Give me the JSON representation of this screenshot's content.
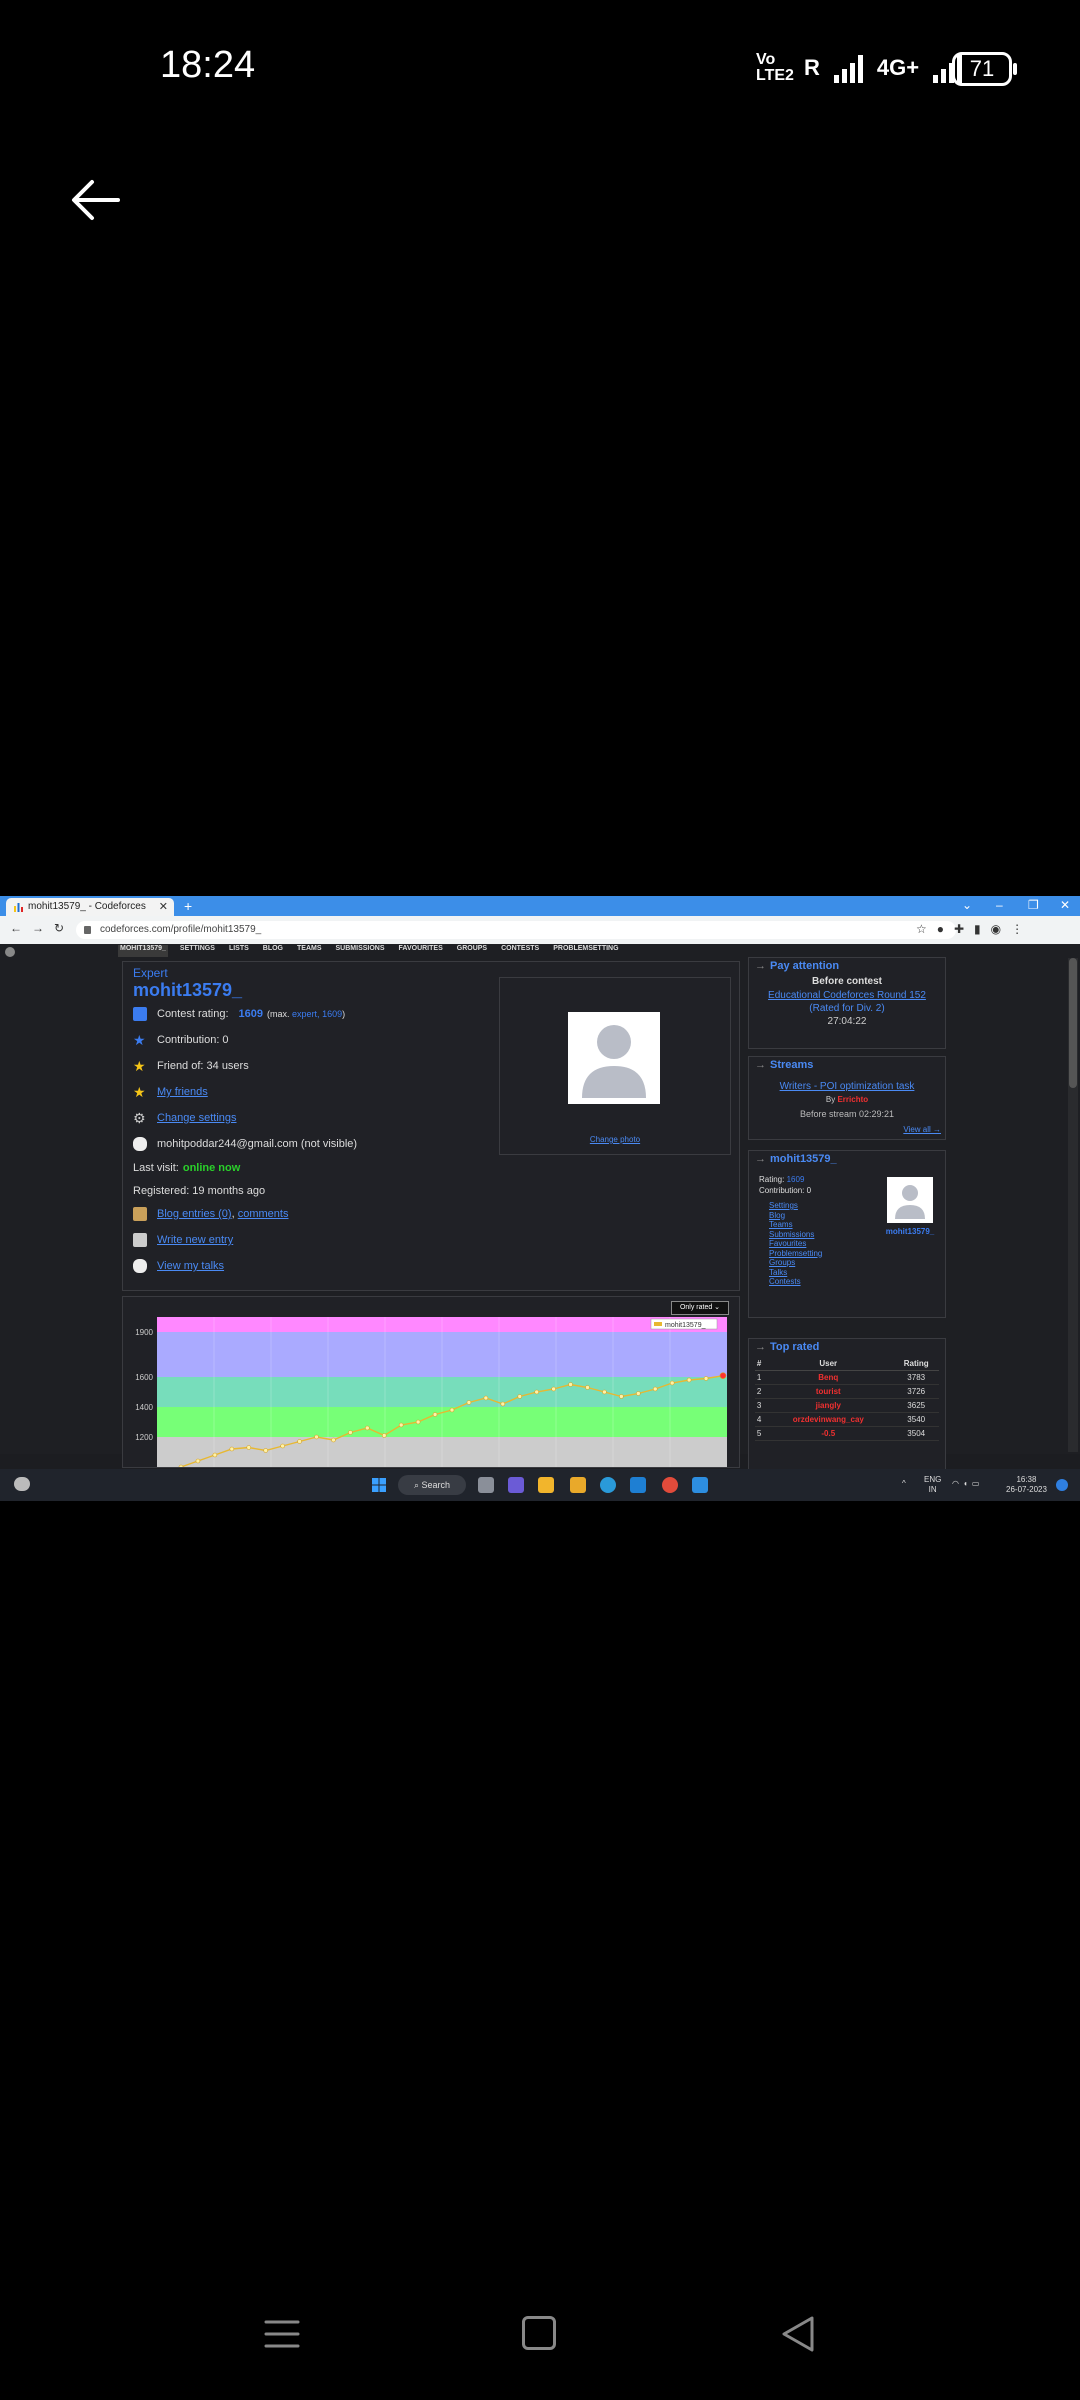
{
  "phone": {
    "time": "18:24",
    "network": "Vo LTE2",
    "roaming": "R",
    "net_type": "4G+",
    "battery": "71"
  },
  "browser": {
    "tab_title": "mohit13579_ - Codeforces",
    "url": "codeforces.com/profile/mohit13579_"
  },
  "menu": [
    "MOHIT13579_",
    "SETTINGS",
    "LISTS",
    "BLOG",
    "TEAMS",
    "SUBMISSIONS",
    "FAVOURITES",
    "GROUPS",
    "CONTESTS",
    "PROBLEMSETTING"
  ],
  "profile": {
    "rank": "Expert",
    "handle": "mohit13579_",
    "rating_label": "Contest rating:",
    "rating": "1609",
    "max_prefix": "(max.",
    "max_rank": "expert,",
    "max_rating": "1609",
    "max_suffix": ")",
    "contribution": "Contribution: 0",
    "friend_of": "Friend of: 34 users",
    "my_friends": "My friends",
    "change_settings": "Change settings",
    "email": "mohitpoddar244@gmail.com (not visible)",
    "last_visit_label": "Last visit:",
    "last_visit": "online now",
    "registered": "Registered: 19 months ago",
    "blog_entries": "Blog entries (0)",
    "comments": "comments",
    "write_entry": "Write new entry",
    "view_talks": "View my talks",
    "change_photo": "Change photo"
  },
  "chart": {
    "dropdown": "Only rated",
    "legend": "mohit13579_"
  },
  "chart_data": {
    "type": "line",
    "yticks": [
      "1900",
      "1600",
      "1400",
      "1200"
    ],
    "ylim": [
      1000,
      2000
    ],
    "legend": "mohit13579_",
    "bands": [
      {
        "from": 1000,
        "to": 1200,
        "color": "#cccccc"
      },
      {
        "from": 1200,
        "to": 1400,
        "color": "#77ff77"
      },
      {
        "from": 1400,
        "to": 1600,
        "color": "#77ddbb"
      },
      {
        "from": 1600,
        "to": 1900,
        "color": "#aaaaff"
      },
      {
        "from": 1900,
        "to": 2000,
        "color": "#ff88ff"
      }
    ],
    "y": [
      1000,
      1040,
      1080,
      1120,
      1130,
      1110,
      1140,
      1170,
      1200,
      1180,
      1230,
      1260,
      1210,
      1280,
      1300,
      1350,
      1380,
      1430,
      1460,
      1420,
      1470,
      1500,
      1520,
      1550,
      1530,
      1500,
      1470,
      1490,
      1520,
      1560,
      1580,
      1590,
      1609
    ]
  },
  "sidebar": {
    "pay_attention": {
      "title": "Pay attention",
      "subtitle": "Before contest",
      "contest": "Educational Codeforces Round 152",
      "rated": "(Rated for Div. 2)",
      "countdown": "27:04:22"
    },
    "streams": {
      "title": "Streams",
      "stream": "Writers - POI optimization task",
      "by": "By",
      "author": "Errichto",
      "before": "Before stream 02:29:21",
      "view_all": "View all →"
    },
    "user_box": {
      "title": "mohit13579_",
      "rating_label": "Rating:",
      "rating": "1609",
      "contribution": "Contribution: 0",
      "links": [
        "Settings",
        "Blog",
        "Teams",
        "Submissions",
        "Favourites",
        "Problemsetting",
        "Groups",
        "Talks",
        "Contests"
      ],
      "avatar_name": "mohit13579_"
    },
    "top_rated": {
      "title": "Top rated",
      "headers": [
        "#",
        "User",
        "Rating"
      ],
      "rows": [
        [
          "1",
          "Benq",
          "3783"
        ],
        [
          "2",
          "tourist",
          "3726"
        ],
        [
          "3",
          "jiangly",
          "3625"
        ],
        [
          "4",
          "orzdevinwang_cay",
          "3540"
        ],
        [
          "5",
          "-0.5",
          "3504"
        ]
      ]
    }
  },
  "taskbar": {
    "search": "Search",
    "lang": "ENG",
    "region": "IN",
    "time": "16:38",
    "date": "26-07-2023"
  }
}
